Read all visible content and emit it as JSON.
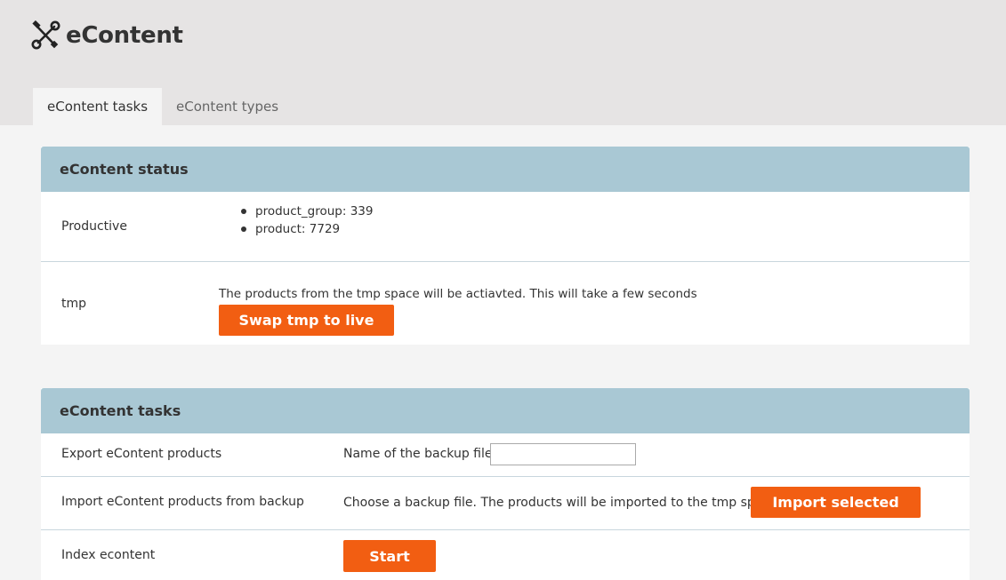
{
  "app": {
    "title": "eContent",
    "icon": "tools-icon"
  },
  "tabs": [
    {
      "label": "eContent tasks",
      "active": true
    },
    {
      "label": "eContent types",
      "active": false
    }
  ],
  "status_panel": {
    "heading": "eContent status",
    "productive": {
      "label": "Productive",
      "items": [
        "product_group: 339",
        "product: 7729"
      ]
    },
    "tmp": {
      "label": "tmp",
      "description": "The products from the tmp space will be actiavted. This will take a few seconds",
      "button_label": "Swap tmp to live"
    }
  },
  "tasks_panel": {
    "heading": "eContent tasks",
    "export": {
      "label": "Export eContent products",
      "field_label": "Name of the backup file:",
      "field_value": ""
    },
    "import": {
      "label": "Import eContent products from backup",
      "description": "Choose a backup file. The products will be imported to the tmp space",
      "button_label": "Import selected"
    },
    "index": {
      "label": "Index econtent",
      "button_label": "Start"
    }
  },
  "colors": {
    "accent": "#f25e12",
    "panel_header": "#a9c8d4",
    "header_bg": "#e6e4e4",
    "page_bg": "#f4f4f4"
  }
}
